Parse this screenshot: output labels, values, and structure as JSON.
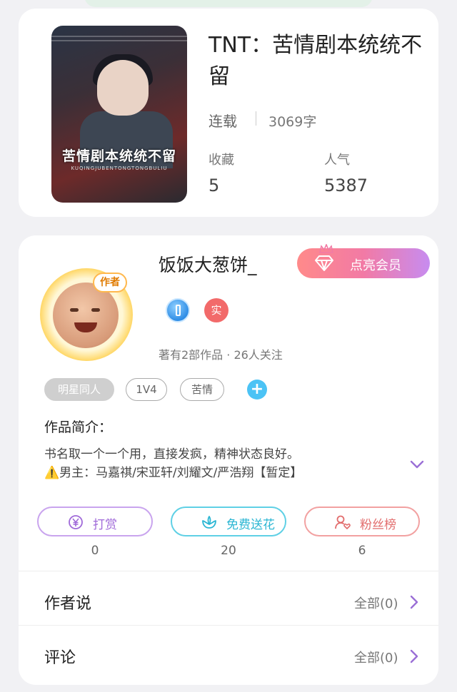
{
  "book": {
    "cover": {
      "poster_title": "苦情剧本统统不留",
      "poster_sub": "KUQINGJUBENTONGTONGBULIU"
    },
    "title": "TNT：苦情剧本统统不留",
    "status": "连载",
    "word_count": "3069字",
    "stats": [
      {
        "label": "收藏",
        "value": "5"
      },
      {
        "label": "人气",
        "value": "5387"
      }
    ]
  },
  "author": {
    "name": "饭饭大葱饼_",
    "avatar_tag": "作者",
    "vip_button": "点亮会员",
    "badge_real": "实",
    "meta": "著有2部作品 · 26人关注",
    "tags": [
      "明星同人",
      "1V4",
      "苦情"
    ],
    "tag_add": "+",
    "intro_heading": "作品简介：",
    "intro_lines": [
      "书名取一个一个用，直接发疯，精神状态良好。",
      "⚠️男主：马嘉祺/宋亚轩/刘耀文/严浩翔【暂定】"
    ],
    "actions": [
      {
        "label": "打赏",
        "count": "0",
        "icon": "yen-icon"
      },
      {
        "label": "免费送花",
        "count": "20",
        "icon": "flower-icon"
      },
      {
        "label": "粉丝榜",
        "count": "6",
        "icon": "fan-user-icon"
      }
    ],
    "rows": [
      {
        "title": "作者说",
        "link": "全部(0)"
      },
      {
        "title": "评论",
        "link": "全部(0)"
      }
    ]
  },
  "colors": {
    "vip_gradient": [
      "#ff8a8a",
      "#c78cf0"
    ],
    "reward": "#a06ad9",
    "flower": "#2bb6d3",
    "fans": "#e26d6d",
    "tag_add": "#4cc3f5",
    "chevron": "#9a6fd6"
  }
}
